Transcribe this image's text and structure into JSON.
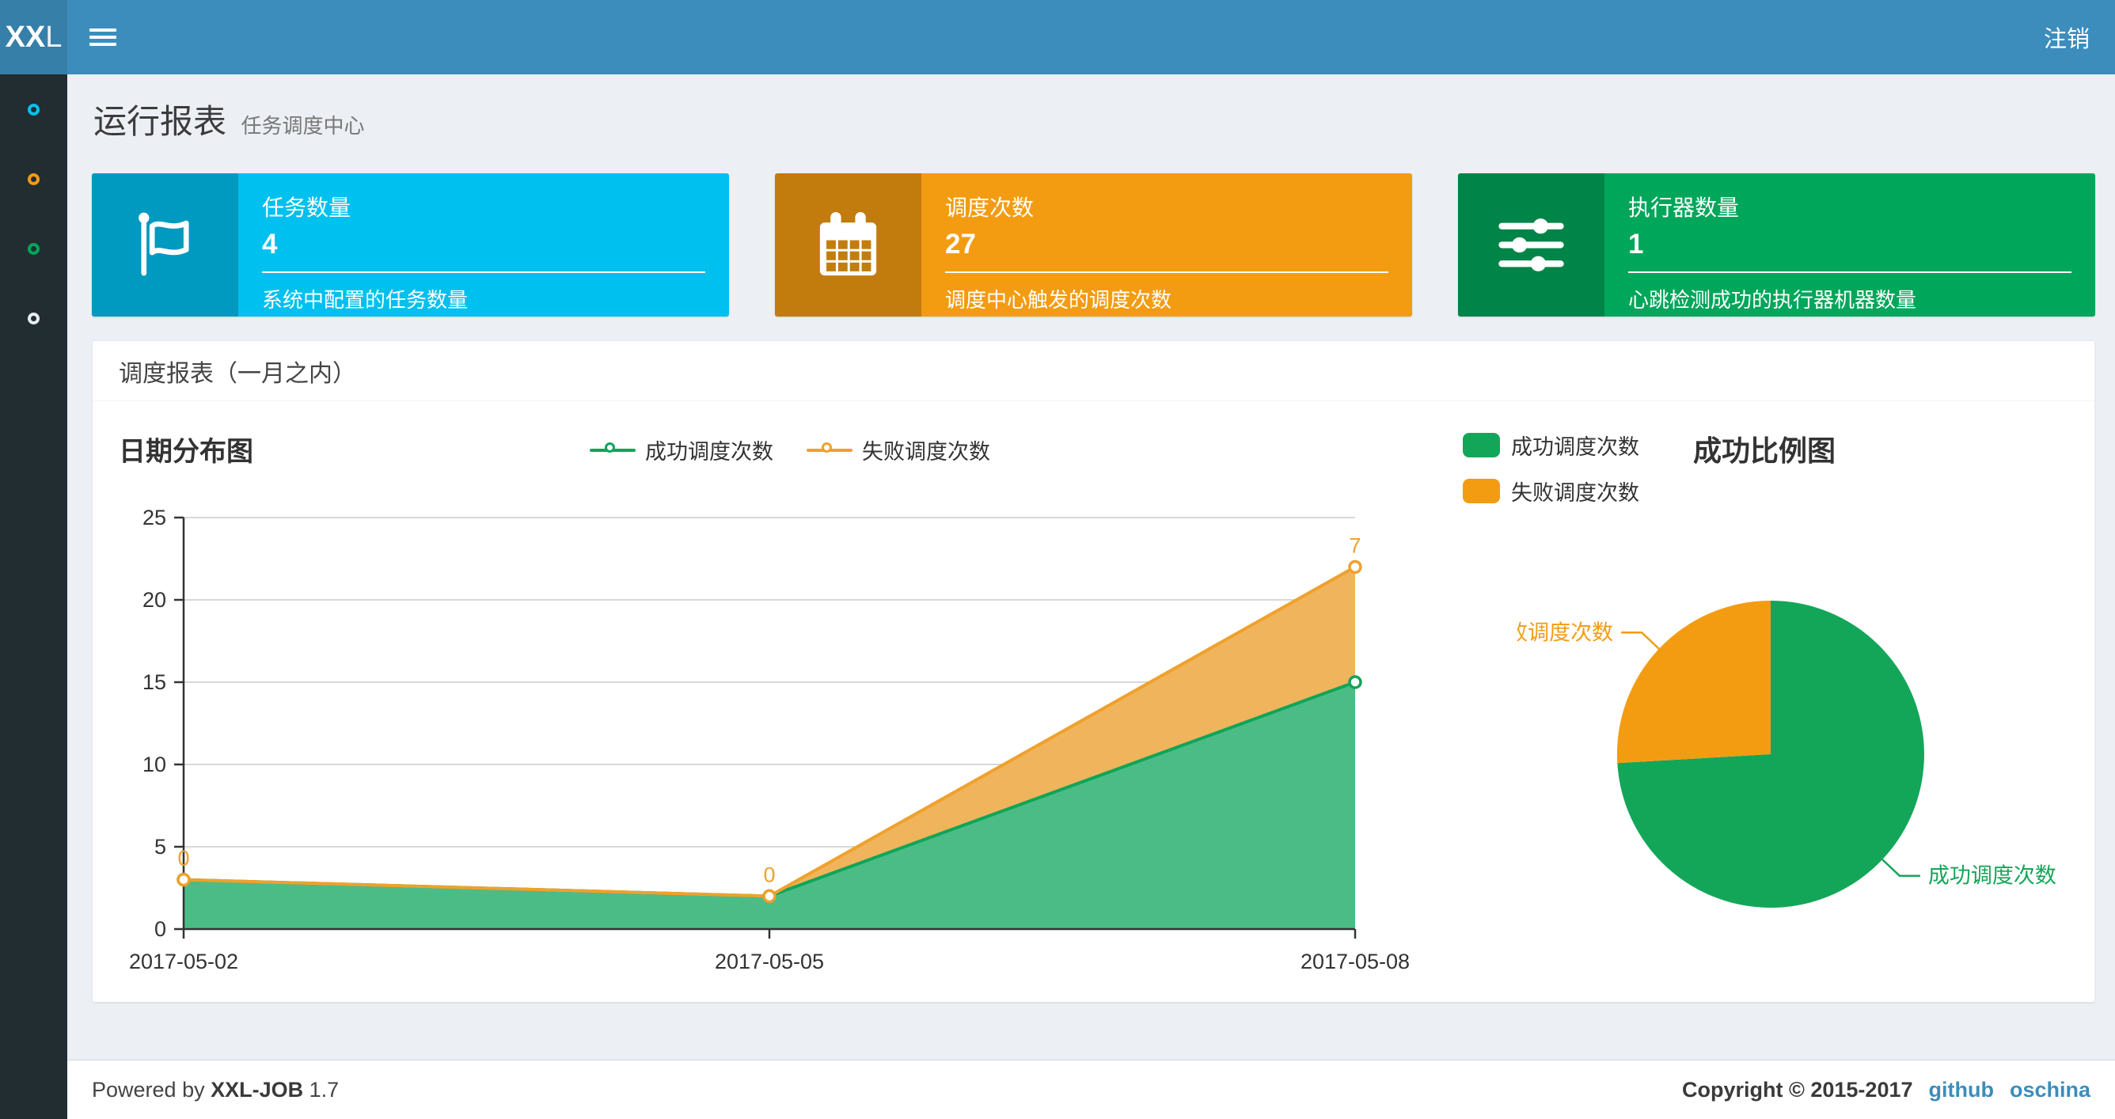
{
  "theme": {
    "navbar_bg": "#3c8dbc",
    "logo_bg": "#367fa9",
    "sidebar_bg": "#222d32",
    "content_bg": "#ecf0f5",
    "link_blue": "#3c8dbc"
  },
  "navbar": {
    "logo_bold": "XX",
    "logo_light": "L",
    "logout_label": "注销"
  },
  "sidebar": {
    "items": [
      {
        "icon": "circle-outline-icon",
        "color": "#00c0ef"
      },
      {
        "icon": "circle-outline-icon",
        "color": "#f39c12"
      },
      {
        "icon": "circle-outline-icon",
        "color": "#00a65a"
      },
      {
        "icon": "circle-outline-icon",
        "color": "#e8ecf1"
      }
    ]
  },
  "page_header": {
    "title": "运行报表",
    "subtitle": "任务调度中心"
  },
  "info_boxes": [
    {
      "label": "任务数量",
      "value": "4",
      "description": "系统中配置的任务数量",
      "color": "#00c0ef",
      "icon": "flag-icon"
    },
    {
      "label": "调度次数",
      "value": "27",
      "description": "调度中心触发的调度次数",
      "color": "#f39c12",
      "icon": "calendar-icon"
    },
    {
      "label": "执行器数量",
      "value": "1",
      "description": "心跳检测成功的执行器机器数量",
      "color": "#00a65a",
      "icon": "sliders-icon"
    }
  ],
  "report_card": {
    "title": "调度报表（一月之内）"
  },
  "chart_data": [
    {
      "type": "area",
      "title": "日期分布图",
      "stacked": true,
      "grid": true,
      "legend_position": "top-center",
      "x": [
        "2017-05-02",
        "2017-05-05",
        "2017-05-08"
      ],
      "series": [
        {
          "name": "成功调度次数",
          "values": [
            3,
            2,
            15
          ],
          "line_color": "#0ea558",
          "fill_color": "#4cbc86"
        },
        {
          "name": "失败调度次数",
          "values": [
            0,
            0,
            7
          ],
          "line_color": "#efa12c",
          "fill_color": "#f0b45c",
          "point_labels": [
            "0",
            "0",
            "7"
          ]
        }
      ],
      "ylim": [
        0,
        25
      ],
      "yticks": [
        0,
        5,
        10,
        15,
        20,
        25
      ]
    },
    {
      "type": "pie",
      "title": "成功比例图",
      "legend_position": "top-left",
      "slices": [
        {
          "name": "成功调度次数",
          "value": 20,
          "color": "#13a659"
        },
        {
          "name": "失败调度次数",
          "value": 7,
          "color": "#f39c12"
        }
      ]
    }
  ],
  "footer": {
    "powered_by": "Powered by",
    "product": "XXL-JOB",
    "version": "1.7",
    "copyright": "Copyright © 2015-2017",
    "links": [
      {
        "label": "github"
      },
      {
        "label": "oschina"
      }
    ]
  }
}
